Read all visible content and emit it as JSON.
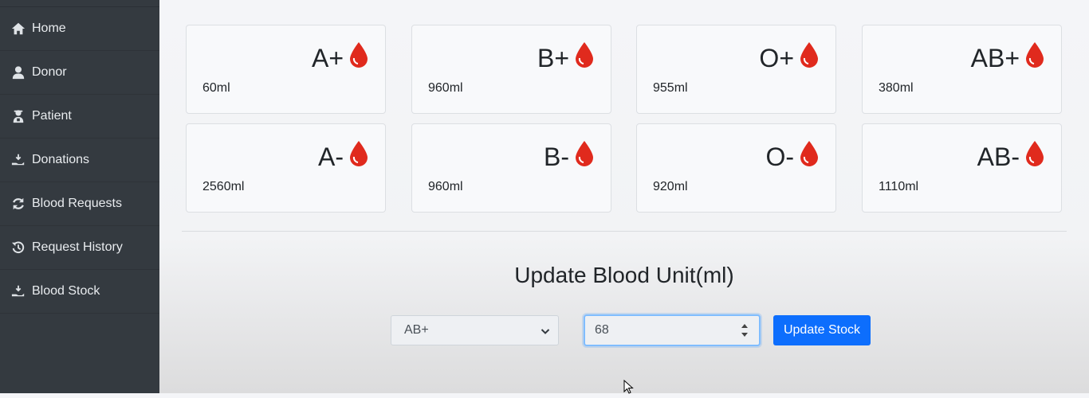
{
  "sidebar": {
    "items": [
      {
        "label": "Home",
        "icon": "home-icon"
      },
      {
        "label": "Donor",
        "icon": "user-icon"
      },
      {
        "label": "Patient",
        "icon": "patient-icon"
      },
      {
        "label": "Donations",
        "icon": "hand-donate-icon"
      },
      {
        "label": "Blood Requests",
        "icon": "refresh-icon"
      },
      {
        "label": "Request History",
        "icon": "history-icon"
      },
      {
        "label": "Blood Stock",
        "icon": "hand-donate-icon"
      }
    ]
  },
  "stock": [
    {
      "group": "A+",
      "amount": "60ml"
    },
    {
      "group": "B+",
      "amount": "960ml"
    },
    {
      "group": "O+",
      "amount": "955ml"
    },
    {
      "group": "AB+",
      "amount": "380ml"
    },
    {
      "group": "A-",
      "amount": "2560ml"
    },
    {
      "group": "B-",
      "amount": "960ml"
    },
    {
      "group": "O-",
      "amount": "920ml"
    },
    {
      "group": "AB-",
      "amount": "1110ml"
    }
  ],
  "update": {
    "title": "Update Blood Unit(ml)",
    "selected_group": "AB+",
    "unit_value": "68",
    "button_label": "Update Stock"
  },
  "colors": {
    "sidebar_bg": "#343a40",
    "accent": "#0d6efd",
    "drop": "#e02a1d"
  }
}
